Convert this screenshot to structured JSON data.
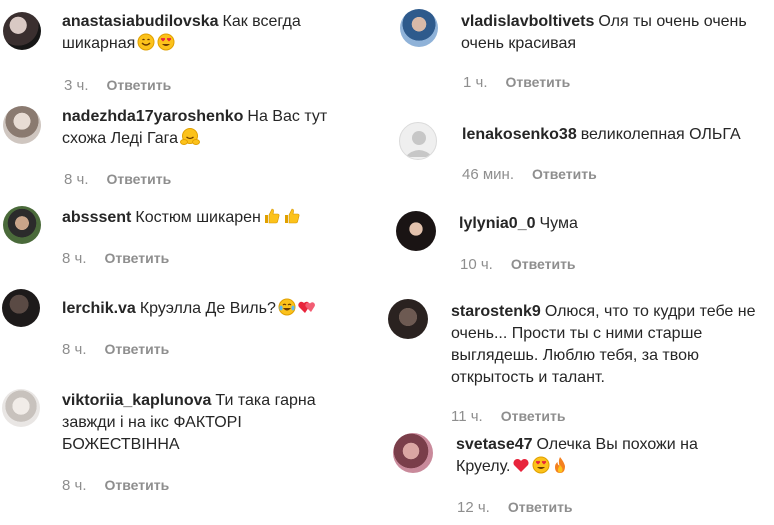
{
  "reply_label": "Ответить",
  "left": [
    {
      "user": "anastasiabudilovska",
      "text": "Как всегда шикарная",
      "emoji": [
        "smile-emoji",
        "heart-eyes-emoji"
      ],
      "time": "3 ч."
    },
    {
      "user": "nadezhda17yaroshenko",
      "text": "На Вас тут схожа Леді Гага",
      "emoji": [
        "hug-emoji"
      ],
      "time": "8 ч."
    },
    {
      "user": "absssent",
      "text": "Костюм шикарен",
      "emoji": [
        "thumbs-up-emoji",
        "thumbs-up-emoji"
      ],
      "time": "8 ч."
    },
    {
      "user": "lerchik.va",
      "text": "Круэлла Де Виль?",
      "emoji": [
        "tears-of-joy-emoji",
        "hearts-emoji"
      ],
      "time": "8 ч."
    },
    {
      "user": "viktoriia_kaplunova",
      "text": "Ти така гарна завжди і на ікс ФАКТОРІ БОЖЕСТВІННА",
      "emoji": [],
      "time": "8 ч."
    }
  ],
  "right": [
    {
      "user": "vladislavboltivets",
      "text": "Оля ты очень очень очень красивая",
      "emoji": [],
      "time": "1 ч."
    },
    {
      "user": "lenakosenko38",
      "text": "великолепная ОЛЬГА",
      "emoji": [],
      "time": "46 мин."
    },
    {
      "user": "lylynia0_0",
      "text": "Чума",
      "emoji": [],
      "time": "10 ч."
    },
    {
      "user": "starostenk9",
      "text": "Олюся, что то кудри тебе не очень... Прости ты с ними старше выглядешь. Люблю тебя, за твою открытость и талант.",
      "emoji": [],
      "time": "11 ч."
    },
    {
      "user": "svetase47",
      "text": "Олечка Вы похожи на Круелу.",
      "emoji": [
        "red-heart-emoji",
        "heart-eyes-emoji",
        "fire-emoji"
      ],
      "time": "12 ч."
    }
  ]
}
